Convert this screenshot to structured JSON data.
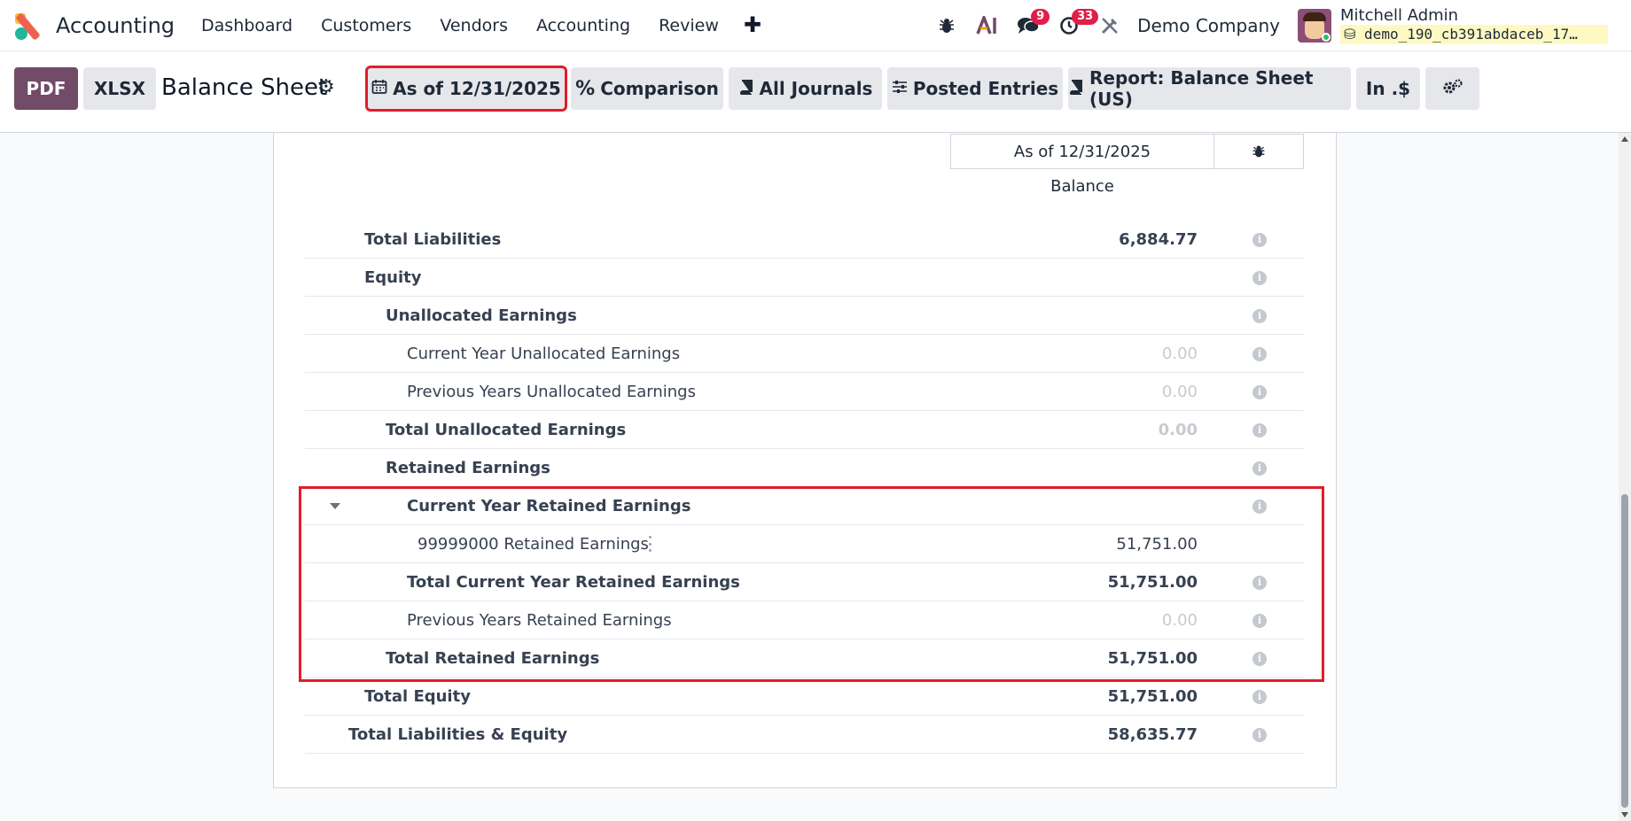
{
  "navbar": {
    "app_name": "Accounting",
    "menu": [
      "Dashboard",
      "Customers",
      "Vendors",
      "Accounting",
      "Review"
    ],
    "plus": "✚",
    "badges": {
      "messages": "9",
      "activities": "33"
    },
    "company": "Demo Company",
    "user_name": "Mitchell Admin",
    "db_name": "demo_190_cb391abdaceb_17…"
  },
  "toolbar": {
    "pdf": "PDF",
    "xlsx": "XLSX",
    "title": "Balance Sheet",
    "date_filter": "As of 12/31/2025",
    "comparison": "Comparison",
    "journals": "All Journals",
    "entries": "Posted Entries",
    "report": "Report: Balance Sheet (US)",
    "currency": "In .$"
  },
  "report": {
    "column_header": "As of 12/31/2025",
    "column_sub": "Balance",
    "rows": [
      {
        "label": "Total Liabilities",
        "value": "6,884.77"
      },
      {
        "label": "Equity",
        "value": ""
      },
      {
        "label": "Unallocated Earnings",
        "value": ""
      },
      {
        "label": "Current Year Unallocated Earnings",
        "value": "0.00"
      },
      {
        "label": "Previous Years Unallocated Earnings",
        "value": "0.00"
      },
      {
        "label": "Total Unallocated Earnings",
        "value": "0.00"
      },
      {
        "label": "Retained Earnings",
        "value": ""
      },
      {
        "label": "Current Year Retained Earnings",
        "value": ""
      },
      {
        "label": "99999000 Retained Earnings",
        "value": "51,751.00"
      },
      {
        "label": "Total Current Year Retained Earnings",
        "value": "51,751.00"
      },
      {
        "label": "Previous Years Retained Earnings",
        "value": "0.00"
      },
      {
        "label": "Total Retained Earnings",
        "value": "51,751.00"
      },
      {
        "label": "Total Equity",
        "value": "51,751.00"
      },
      {
        "label": "Total Liabilities & Equity",
        "value": "58,635.77"
      }
    ]
  }
}
